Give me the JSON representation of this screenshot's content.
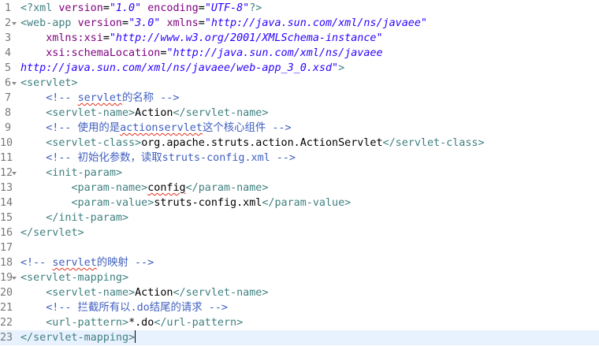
{
  "editor": {
    "current_line": 23,
    "lines": [
      {
        "n": "1",
        "indent": "",
        "tokens": [
          [
            "t",
            "<?xml "
          ],
          [
            "a",
            "version"
          ],
          [
            "x",
            "="
          ],
          [
            "v",
            "\"1.0\""
          ],
          [
            "x",
            " "
          ],
          [
            "a",
            "encoding"
          ],
          [
            "x",
            "="
          ],
          [
            "v",
            "\"UTF-8\""
          ],
          [
            "t",
            "?>"
          ]
        ]
      },
      {
        "n": "2",
        "indent": "",
        "fold": true,
        "tokens": [
          [
            "t",
            "<web-app "
          ],
          [
            "a",
            "version"
          ],
          [
            "x",
            "="
          ],
          [
            "v",
            "\"3.0\""
          ],
          [
            "x",
            " "
          ],
          [
            "a",
            "xmlns"
          ],
          [
            "x",
            "="
          ],
          [
            "v",
            "\"http://java.sun.com/xml/ns/javaee\""
          ]
        ]
      },
      {
        "n": "3",
        "indent": "    ",
        "tokens": [
          [
            "a",
            "xmlns:xsi"
          ],
          [
            "x",
            "="
          ],
          [
            "v",
            "\"http://www.w3.org/2001/XMLSchema-instance\""
          ]
        ]
      },
      {
        "n": "4",
        "indent": "    ",
        "tokens": [
          [
            "a",
            "xsi:schemaLocation"
          ],
          [
            "x",
            "="
          ],
          [
            "v",
            "\"http://java.sun.com/xml/ns/javaee"
          ]
        ]
      },
      {
        "n": "5",
        "indent": "",
        "tokens": [
          [
            "v",
            "http://java.sun.com/xml/ns/javaee/web-app_3_0.xsd\""
          ],
          [
            "t",
            ">"
          ]
        ]
      },
      {
        "n": "6",
        "indent": "",
        "fold": true,
        "tokens": [
          [
            "t",
            "<servlet>"
          ]
        ]
      },
      {
        "n": "7",
        "indent": "    ",
        "tokens": [
          [
            "c",
            "<!-- "
          ],
          [
            "c sq",
            "servlet"
          ],
          [
            "c",
            "的名称 -->"
          ]
        ]
      },
      {
        "n": "8",
        "indent": "    ",
        "tokens": [
          [
            "t",
            "<servlet-name>"
          ],
          [
            "x",
            "Action"
          ],
          [
            "t",
            "</servlet-name>"
          ]
        ]
      },
      {
        "n": "9",
        "indent": "    ",
        "tokens": [
          [
            "c",
            "<!-- 使用的是"
          ],
          [
            "c sq",
            "actionservlet"
          ],
          [
            "c",
            "这个核心组件 -->"
          ]
        ]
      },
      {
        "n": "10",
        "indent": "    ",
        "tokens": [
          [
            "t",
            "<servlet-class>"
          ],
          [
            "x",
            "org.apache.struts.action.ActionServlet"
          ],
          [
            "t",
            "</servlet-class>"
          ]
        ]
      },
      {
        "n": "11",
        "indent": "    ",
        "tokens": [
          [
            "c",
            "<!-- 初始化参数，读取struts-config.xml -->"
          ]
        ]
      },
      {
        "n": "12",
        "indent": "    ",
        "fold": true,
        "tokens": [
          [
            "t",
            "<init-param>"
          ]
        ]
      },
      {
        "n": "13",
        "indent": "        ",
        "tokens": [
          [
            "t",
            "<param-name>"
          ],
          [
            "x sq",
            "config"
          ],
          [
            "t",
            "</param-name>"
          ]
        ]
      },
      {
        "n": "14",
        "indent": "        ",
        "tokens": [
          [
            "t",
            "<param-value>"
          ],
          [
            "x",
            "struts-config.xml"
          ],
          [
            "t",
            "</param-value>"
          ]
        ]
      },
      {
        "n": "15",
        "indent": "    ",
        "tokens": [
          [
            "t",
            "</init-param>"
          ]
        ]
      },
      {
        "n": "16",
        "indent": "",
        "tokens": [
          [
            "t",
            "</servlet>"
          ]
        ]
      },
      {
        "n": "17",
        "indent": "",
        "tokens": []
      },
      {
        "n": "18",
        "indent": "",
        "tokens": [
          [
            "c",
            "<!-- "
          ],
          [
            "c sq",
            "servlet"
          ],
          [
            "c",
            "的映射 -->"
          ]
        ]
      },
      {
        "n": "19",
        "indent": "",
        "fold": true,
        "tokens": [
          [
            "t",
            "<servlet-mapping>"
          ]
        ]
      },
      {
        "n": "20",
        "indent": "    ",
        "tokens": [
          [
            "t",
            "<servlet-name>"
          ],
          [
            "x",
            "Action"
          ],
          [
            "t",
            "</servlet-name>"
          ]
        ]
      },
      {
        "n": "21",
        "indent": "    ",
        "tokens": [
          [
            "c",
            "<!-- 拦截所有以.do结尾的请求 -->"
          ]
        ]
      },
      {
        "n": "22",
        "indent": "    ",
        "tokens": [
          [
            "t",
            "<url-pattern>"
          ],
          [
            "x",
            "*.do"
          ],
          [
            "t",
            "</url-pattern>"
          ]
        ]
      },
      {
        "n": "23",
        "indent": "",
        "cursor": true,
        "tokens": [
          [
            "t",
            "</servlet-mapping>"
          ]
        ]
      }
    ]
  },
  "colors": {
    "tag": "#3f7f7f",
    "attribute": "#7f007f",
    "attribute_value": "#2a00ff",
    "comment": "#3f5fbf",
    "text": "#000000",
    "line_number": "#787878",
    "current_line_bg": "#e8f2fe",
    "squiggle": "#e0301e"
  }
}
